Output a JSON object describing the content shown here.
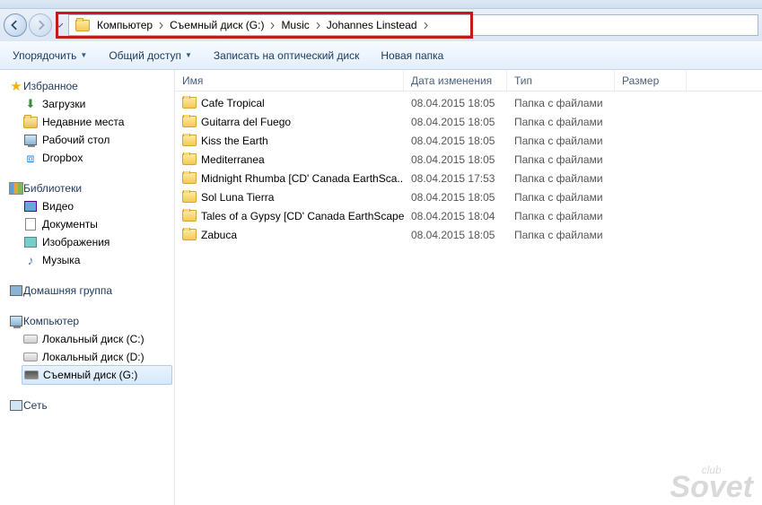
{
  "breadcrumb": {
    "items": [
      "Компьютер",
      "Съемный диск (G:)",
      "Music",
      "Johannes Linstead"
    ]
  },
  "toolbar": {
    "organize": "Упорядочить",
    "share": "Общий доступ",
    "burn": "Записать на оптический диск",
    "newfolder": "Новая папка"
  },
  "sidebar": {
    "favorites": {
      "label": "Избранное",
      "items": [
        {
          "icon": "download",
          "label": "Загрузки"
        },
        {
          "icon": "recent",
          "label": "Недавние места"
        },
        {
          "icon": "desktop",
          "label": "Рабочий стол"
        },
        {
          "icon": "dropbox",
          "label": "Dropbox"
        }
      ]
    },
    "libraries": {
      "label": "Библиотеки",
      "items": [
        {
          "icon": "video",
          "label": "Видео"
        },
        {
          "icon": "docs",
          "label": "Документы"
        },
        {
          "icon": "images",
          "label": "Изображения"
        },
        {
          "icon": "music",
          "label": "Музыка"
        }
      ]
    },
    "homegroup": {
      "label": "Домашняя группа"
    },
    "computer": {
      "label": "Компьютер",
      "items": [
        {
          "icon": "disk",
          "label": "Локальный диск (C:)"
        },
        {
          "icon": "disk",
          "label": "Локальный диск (D:)"
        },
        {
          "icon": "remdisk",
          "label": "Съемный диск (G:)",
          "selected": true
        }
      ]
    },
    "network": {
      "label": "Сеть"
    }
  },
  "columns": {
    "name": "Имя",
    "date": "Дата изменения",
    "type": "Тип",
    "size": "Размер"
  },
  "files": [
    {
      "name": "Cafe Tropical",
      "date": "08.04.2015 18:05",
      "type": "Папка с файлами"
    },
    {
      "name": "Guitarra del Fuego",
      "date": "08.04.2015 18:05",
      "type": "Папка с файлами"
    },
    {
      "name": "Kiss the Earth",
      "date": "08.04.2015 18:05",
      "type": "Папка с файлами"
    },
    {
      "name": "Mediterranea",
      "date": "08.04.2015 18:05",
      "type": "Папка с файлами"
    },
    {
      "name": "Midnight Rhumba [CD' Canada EarthSca...",
      "date": "08.04.2015 17:53",
      "type": "Папка с файлами"
    },
    {
      "name": "Sol Luna Tierra",
      "date": "08.04.2015 18:05",
      "type": "Папка с файлами"
    },
    {
      "name": "Tales of a Gypsy [CD' Canada EarthScape...",
      "date": "08.04.2015 18:04",
      "type": "Папка с файлами"
    },
    {
      "name": "Zabuca",
      "date": "08.04.2015 18:05",
      "type": "Папка с файлами"
    }
  ],
  "watermark": {
    "l1": "club",
    "l2": "Sovet"
  }
}
